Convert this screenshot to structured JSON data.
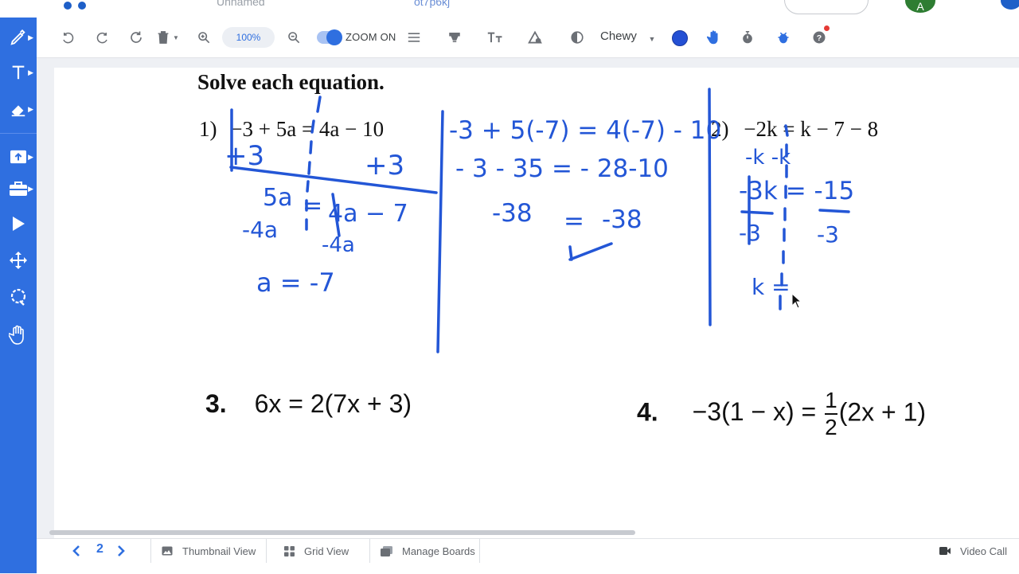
{
  "window": {
    "tab_left": "Unnamed",
    "tab_right": "ot7p6kj",
    "avatar_initial": "A"
  },
  "toolbar": {
    "zoom_value": "100%",
    "zoom_toggle_label": "ZOOM ON",
    "font_name": "Chewy",
    "pen_color": "#2450d4"
  },
  "sidebar": {
    "tools": [
      "pencil-icon",
      "text-icon",
      "eraser-icon",
      "upload-icon",
      "toolbox-icon",
      "pointer-icon",
      "move-icon",
      "lasso-icon",
      "hand-icon"
    ]
  },
  "worksheet": {
    "title": "Solve each equation.",
    "p1_num": "1)",
    "p1_eq": "−3 + 5a = 4a − 10",
    "p2_num": "2)",
    "p2_eq": "−2k = k − 7 − 8",
    "p3_num": "3.",
    "p3_eq": "6x = 2(7x + 3)",
    "p4_num": "4.",
    "p4_left": "−3(1 − x) =",
    "p4_frac_num": "1",
    "p4_frac_den": "2",
    "p4_right": "(2x + 1)"
  },
  "handwriting": {
    "p1_add_left": "+3",
    "p1_add_right": "+3",
    "p1_left_after": "5a",
    "p1_right_after": "4a − 7",
    "p1_sub_left": "-4a",
    "p1_sub_right": "-4a",
    "p1_answer": "a = -7",
    "check_line1": "-3 + 5(-7) = 4(-7) - 10",
    "check_line2": "- 3 - 35 = - 28-10",
    "check_left": "-38",
    "check_eq": "=",
    "check_right": "-38",
    "p2_sub": "-k  -k",
    "p2_line1": "-3k = -15",
    "p2_den_left": "-3",
    "p2_den_right": "-3",
    "p2_answer": "k ="
  },
  "bottombar": {
    "page_number": "2",
    "thumbnail_label": "Thumbnail View",
    "grid_label": "Grid View",
    "manage_label": "Manage Boards",
    "video_label": "Video Call"
  },
  "colors": {
    "sidebar": "#2f6fe0",
    "ink": "#2356d6",
    "accent": "#2f6fe0"
  }
}
